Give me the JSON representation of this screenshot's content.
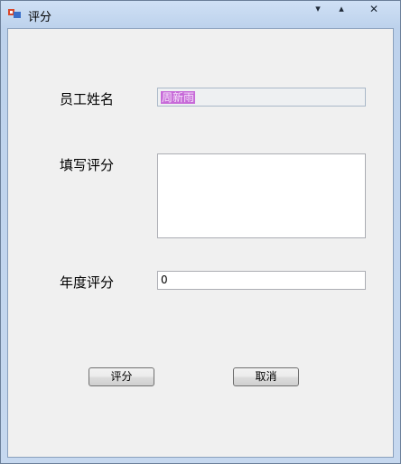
{
  "window": {
    "title": "评分",
    "controls": {
      "minimize": "▾",
      "maximize": "▴",
      "close": "✕"
    }
  },
  "form": {
    "name_label": "员工姓名",
    "name_value": "周新雨",
    "comment_label": "填写评分",
    "comment_value": "",
    "score_label": "年度评分",
    "score_value": "0"
  },
  "buttons": {
    "rate": "评分",
    "cancel": "取消"
  },
  "icons": {
    "app": "app-form-icon"
  },
  "colors": {
    "selection": "#c76ad8",
    "client_bg": "#f0f0f0"
  }
}
